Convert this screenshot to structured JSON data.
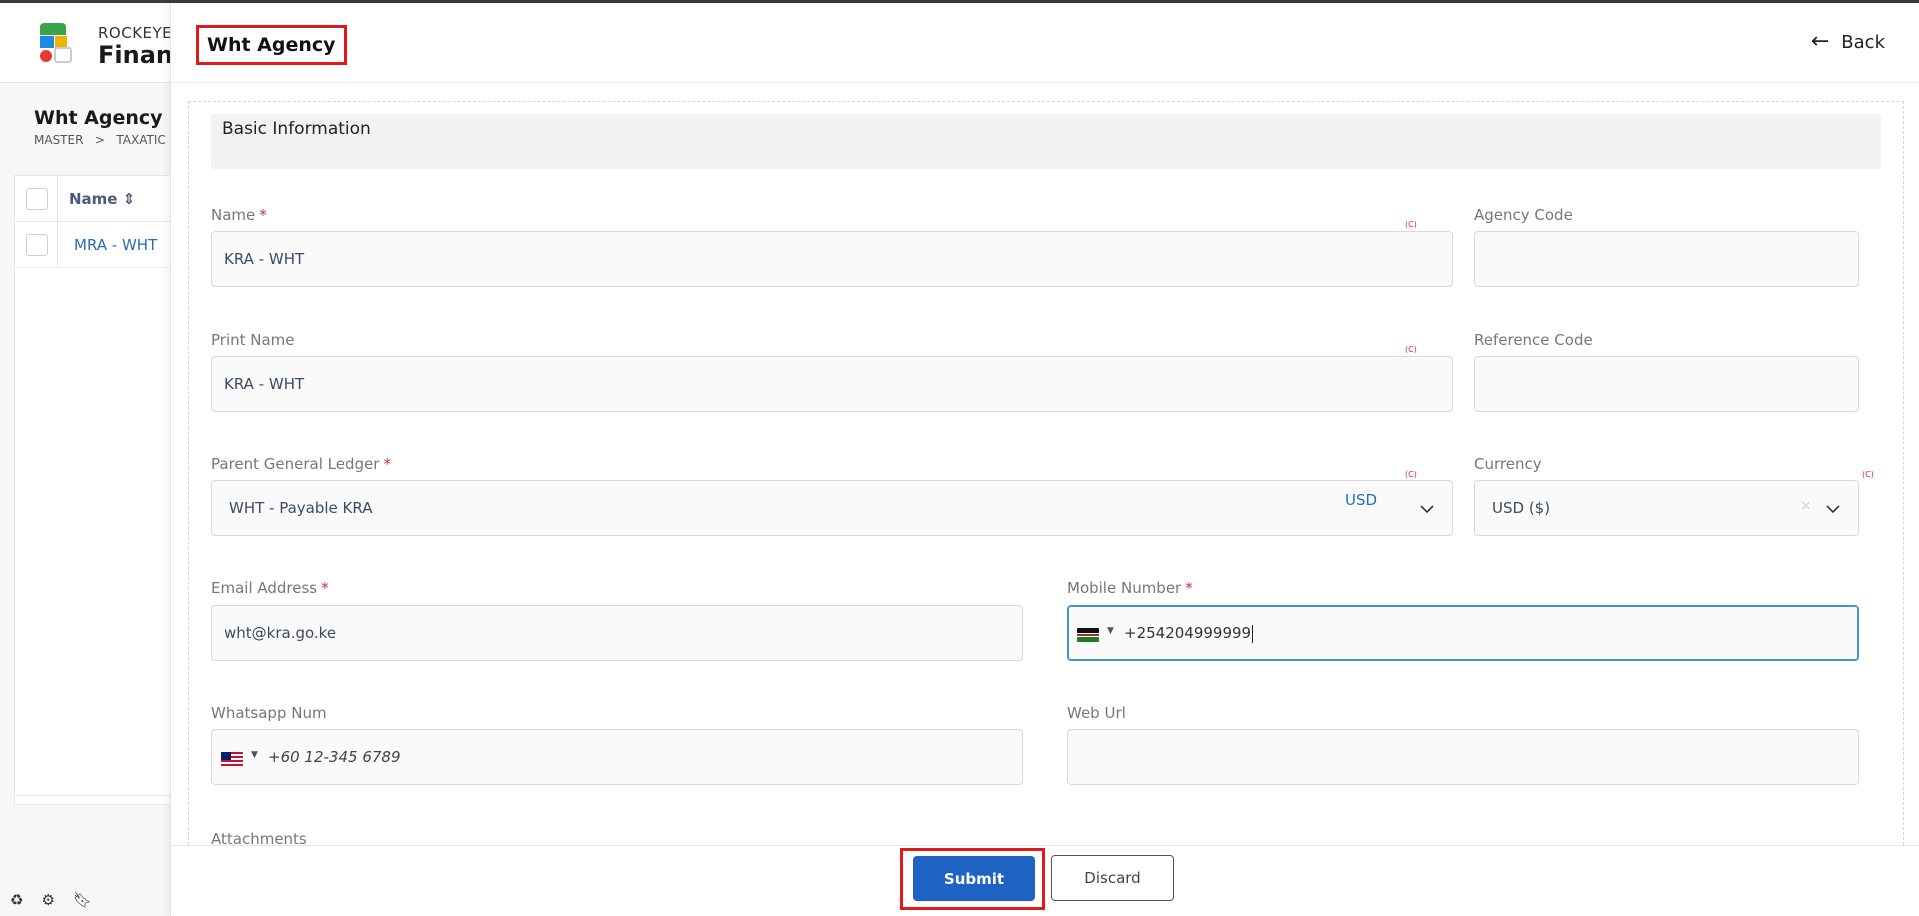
{
  "background_app": {
    "brand_top": "ROCKEYE",
    "brand_bottom": "Financ",
    "page_title": "Wht Agency",
    "breadcrumb_master": "MASTER",
    "breadcrumb_sep": ">",
    "breadcrumb_taxation": "TAXATIC",
    "table_header_name": "Name ⇕",
    "rows": [
      "MRA - WHT"
    ],
    "footer_icons": [
      "recycle-icon",
      "settings-icon",
      "bookmark-icon"
    ]
  },
  "panel": {
    "title": "Wht Agency",
    "back_label": "Back",
    "back_icon": "arrow-left-icon",
    "section_title": "Basic Information",
    "required_mark": "*",
    "c_tag": "(C)",
    "fields": {
      "name": {
        "label": "Name",
        "value": "KRA - WHT",
        "required": true
      },
      "agency_code": {
        "label": "Agency Code",
        "value": ""
      },
      "print_name": {
        "label": "Print Name",
        "value": "KRA - WHT"
      },
      "reference_code": {
        "label": "Reference Code",
        "value": ""
      },
      "parent_general_ledger": {
        "label": "Parent General Ledger",
        "value": "WHT - Payable KRA",
        "currency_tag": "USD",
        "required": true
      },
      "currency": {
        "label": "Currency",
        "value": "USD ($)",
        "clear_icon": "×"
      },
      "email": {
        "label": "Email Address",
        "value": "wht@kra.go.ke",
        "required": true
      },
      "mobile": {
        "label": "Mobile Number",
        "value": "+254204999999",
        "country": "KE",
        "required": true
      },
      "whatsapp": {
        "label": "Whatsapp Num",
        "placeholder": "+60 12-345 6789",
        "country": "MY"
      },
      "web_url": {
        "label": "Web Url",
        "value": ""
      },
      "attachments": {
        "label": "Attachments"
      }
    },
    "buttons": {
      "submit": "Submit",
      "discard": "Discard"
    }
  },
  "colors": {
    "primary": "#1e63c4",
    "highlight_box": "#e01a1a",
    "required": "#d32f2f",
    "link": "#2a6cb8"
  }
}
